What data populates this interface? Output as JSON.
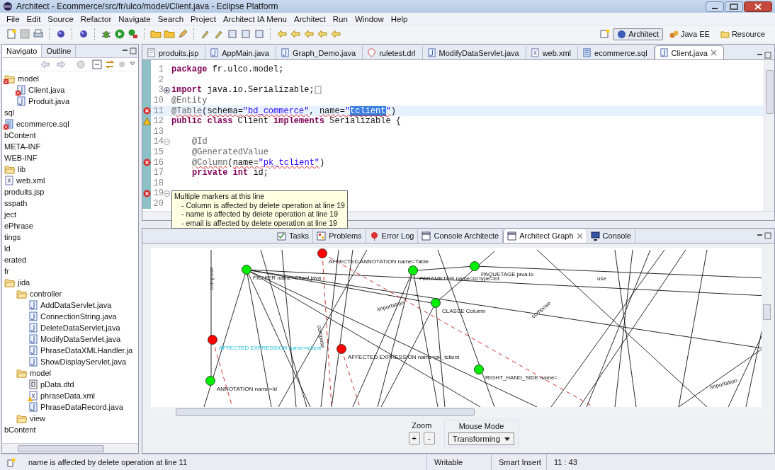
{
  "window": {
    "title": "Architect - Ecommerce/src/fr/ulco/model/Client.java - Eclipse Platform"
  },
  "menu": [
    "File",
    "Edit",
    "Source",
    "Refactor",
    "Navigate",
    "Search",
    "Project",
    "Architect IA Menu",
    "Architect",
    "Run",
    "Window",
    "Help"
  ],
  "perspectives": [
    {
      "label": "Architect",
      "selected": true
    },
    {
      "label": "Java EE",
      "selected": false
    },
    {
      "label": "Resource",
      "selected": false
    }
  ],
  "navigator": {
    "tabs": [
      {
        "label": "Navigato",
        "selected": true
      },
      {
        "label": "Outline",
        "selected": false
      }
    ],
    "tree": [
      {
        "label": "model",
        "kind": "folder_error",
        "children": [
          {
            "label": "Client.java",
            "kind": "java_error"
          },
          {
            "label": "Produit.java",
            "kind": "java"
          }
        ]
      },
      {
        "label": "sql",
        "kind": "plain"
      },
      {
        "label": "ecommerce.sql",
        "kind": "sql_error"
      },
      {
        "label": "bContent",
        "kind": "plain"
      },
      {
        "label": "META-INF",
        "kind": "plain"
      },
      {
        "label": "WEB-INF",
        "kind": "plain"
      },
      {
        "label": "lib",
        "kind": "folder"
      },
      {
        "label": "web.xml",
        "kind": "xml"
      },
      {
        "label": "produits.jsp",
        "kind": "plain"
      },
      {
        "label": "sspath",
        "kind": "plain"
      },
      {
        "label": "ject",
        "kind": "plain"
      },
      {
        "label": "ePhrase",
        "kind": "plain"
      },
      {
        "label": "tings",
        "kind": "plain"
      },
      {
        "label": "ld",
        "kind": "plain"
      },
      {
        "label": "erated",
        "kind": "plain"
      },
      {
        "label": "fr",
        "kind": "plain"
      },
      {
        "label": "jida",
        "kind": "folder",
        "children": [
          {
            "label": "controller",
            "kind": "folder",
            "children": [
              {
                "label": "AddDataServlet.java",
                "kind": "java"
              },
              {
                "label": "ConnectionString.java",
                "kind": "java"
              },
              {
                "label": "DeleteDataServlet.java",
                "kind": "java"
              },
              {
                "label": "ModifyDataServlet.java",
                "kind": "java"
              },
              {
                "label": "PhraseDataXMLHandler.ja",
                "kind": "java"
              },
              {
                "label": "ShowDisplayServlet.java",
                "kind": "java"
              }
            ]
          },
          {
            "label": "model",
            "kind": "folder",
            "children": [
              {
                "label": "pData.dtd",
                "kind": "dtd"
              },
              {
                "label": "phraseData.xml",
                "kind": "xml_warning"
              },
              {
                "label": "PhraseDataRecord.java",
                "kind": "java"
              }
            ]
          },
          {
            "label": "view",
            "kind": "folder"
          }
        ]
      },
      {
        "label": "bContent",
        "kind": "plain"
      }
    ]
  },
  "editor": {
    "tabs": [
      {
        "label": "produits.jsp",
        "kind": "jsp",
        "selected": false
      },
      {
        "label": "AppMain.java",
        "kind": "java",
        "selected": false
      },
      {
        "label": "Graph_Demo.java",
        "kind": "java",
        "selected": false
      },
      {
        "label": "ruletest.drl",
        "kind": "drl",
        "selected": false
      },
      {
        "label": "ModifyDataServlet.java",
        "kind": "java",
        "selected": false
      },
      {
        "label": "web.xml",
        "kind": "xml",
        "selected": false
      },
      {
        "label": "ecommerce.sql",
        "kind": "sql",
        "selected": false
      },
      {
        "label": "Client.java",
        "kind": "java",
        "selected": true
      }
    ],
    "lines": [
      {
        "number": "1",
        "kind": "plain",
        "current": false,
        "indented": false,
        "segments": [
          {
            "kind": "keyword",
            "text": "package"
          },
          {
            "kind": "plain",
            "text": " fr.ulco.model;"
          }
        ]
      },
      {
        "number": "2",
        "kind": "plain",
        "current": false
      },
      {
        "number": "3",
        "kind": "fold_closed",
        "current": false,
        "indented": false,
        "segments": [
          {
            "kind": "keyword",
            "text": "import"
          },
          {
            "kind": "plain",
            "text": " java.io.Serializable;"
          }
        ]
      },
      {
        "number": "10",
        "kind": "plain",
        "current": false,
        "indented": false,
        "segments": [
          {
            "kind": "annotation",
            "text": "@Entity"
          }
        ]
      },
      {
        "number": "11",
        "kind": "error",
        "current": true,
        "indented": false,
        "segments": [
          {
            "kind": "flagged_annotation",
            "text": "@Table"
          },
          {
            "kind": "plain",
            "text": "("
          },
          {
            "kind": "flagged_plain",
            "text": "schema="
          },
          {
            "kind": "flagged_string",
            "text": "\"bd_commerce\""
          },
          {
            "kind": "plain",
            "text": ", "
          },
          {
            "kind": "flagged_plain",
            "text": "name="
          },
          {
            "kind": "flagged_string",
            "text": "\""
          },
          {
            "kind": "flagged_selection",
            "text": "tclient"
          },
          {
            "kind": "flagged_string",
            "text": "\""
          },
          {
            "kind": "plain",
            "text": ")"
          }
        ]
      },
      {
        "number": "12",
        "kind": "warning",
        "current": false,
        "indented": false,
        "segments": [
          {
            "kind": "keyword",
            "text": "public class"
          },
          {
            "kind": "plain",
            "text": " Client "
          },
          {
            "kind": "keyword",
            "text": "implements"
          },
          {
            "kind": "plain",
            "text": " Serializable {"
          }
        ]
      },
      {
        "number": "13",
        "kind": "plain",
        "current": false
      },
      {
        "number": "14",
        "kind": "fold_open",
        "current": false,
        "indented": true,
        "segments": [
          {
            "kind": "annotation",
            "text": "@Id"
          }
        ]
      },
      {
        "number": "15",
        "kind": "plain",
        "current": false,
        "indented": true,
        "segments": [
          {
            "kind": "annotation",
            "text": "@GeneratedValue"
          }
        ]
      },
      {
        "number": "16",
        "kind": "error",
        "current": false,
        "indented": true,
        "segments": [
          {
            "kind": "flagged_annotation",
            "text": "@Column"
          },
          {
            "kind": "plain",
            "text": "("
          },
          {
            "kind": "flagged_plain",
            "text": "name="
          },
          {
            "kind": "flagged_string",
            "text": "\"pk_tclient\""
          },
          {
            "kind": "plain",
            "text": ")"
          }
        ]
      },
      {
        "number": "17",
        "kind": "plain",
        "current": false,
        "indented": true,
        "segments": [
          {
            "kind": "keyword",
            "text": "private int"
          },
          {
            "kind": "plain",
            "text": " id;"
          }
        ]
      },
      {
        "number": "18",
        "kind": "plain",
        "current": false
      },
      {
        "number": "19",
        "kind": "error_fold_open",
        "current": false
      },
      {
        "number": "20",
        "kind": "plain",
        "current": false
      }
    ],
    "tooltip": {
      "title": "Multiple markers at this line",
      "items": [
        "- Column is affected by delete operation at line 19",
        "- name is affected by delete operation at line 19",
        "- email is affected by delete operation at line 19"
      ]
    }
  },
  "bottom_panel": {
    "tabs": [
      {
        "label": "Tasks",
        "kind": "tasks",
        "selected": false
      },
      {
        "label": "Problems",
        "kind": "problems",
        "selected": false
      },
      {
        "label": "Error Log",
        "kind": "errorlog",
        "selected": false
      },
      {
        "label": "Console Architecte",
        "kind": "window",
        "selected": false
      },
      {
        "label": "Architect Graph",
        "kind": "window",
        "selected": true
      },
      {
        "label": "Console",
        "kind": "console",
        "selected": false
      }
    ],
    "graph": {
      "nodes": [
        {
          "label": "AFFECTED ANNOTATION name=Table",
          "color": "#ff0000",
          "highlighted": false
        },
        {
          "label": "FICHIER name=Client.java",
          "color": "#00ee00",
          "highlighted": false
        },
        {
          "label": "PARAMETER name=id type=int",
          "color": "#00ee00",
          "highlighted": false
        },
        {
          "label": "PAQUETAGE java.io",
          "color": "#00ee00",
          "highlighted": false
        },
        {
          "label": "CLASSE Column",
          "color": "#00ee00",
          "highlighted": false
        },
        {
          "label": "AFFECTED EXPRESSION name=tclient",
          "color": "#ff0000",
          "highlighted": true
        },
        {
          "label": "AFFECTED EXPRESSION name=pk_tclient",
          "color": "#ff0000",
          "highlighted": false
        },
        {
          "label": "RIGHT_HAND_SIDE name=",
          "color": "#00ee00",
          "highlighted": false
        },
        {
          "label": "ANNOTATION name=Id",
          "color": "#00ee00",
          "highlighted": false
        }
      ],
      "edge_labels": [
        "compose",
        "importation",
        "compose",
        "use",
        "compose",
        "importation"
      ]
    },
    "zoom": {
      "label": "Zoom",
      "buttons": [
        "+",
        "-"
      ]
    },
    "mouse_mode": {
      "label": "Mouse Mode",
      "value": "Transforming"
    }
  },
  "status_bar": {
    "message": "name is affected by delete operation at line 11",
    "mode": "Writable",
    "insert": "Smart Insert",
    "position": "11 : 43"
  }
}
